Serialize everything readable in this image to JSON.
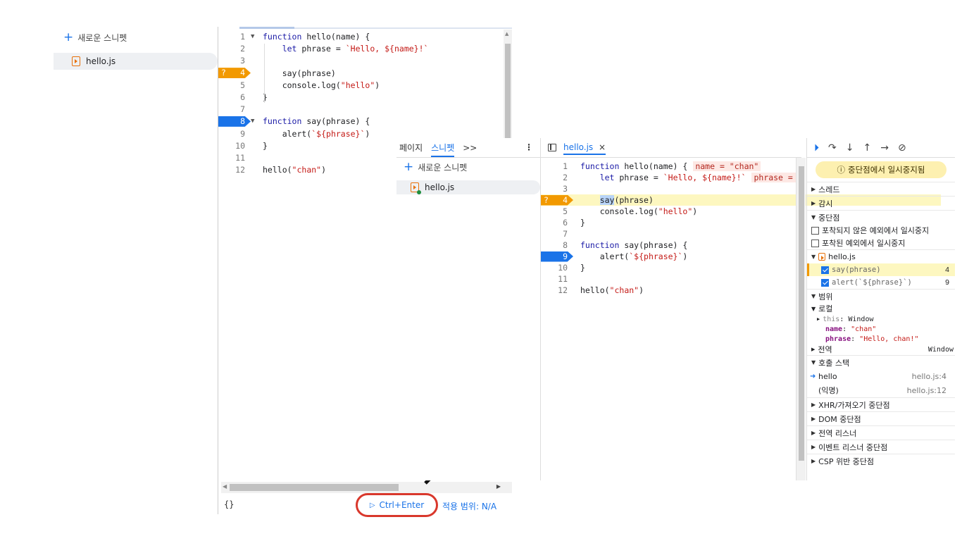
{
  "background": {
    "sidebar": {
      "new_snippet": "새로운 스니펫",
      "file": "hello.js"
    },
    "editor": {
      "lines": [
        {
          "n": "1",
          "code": "function hello(name) {"
        },
        {
          "n": "2",
          "code": "    let phrase = `Hello, ${name}!`"
        },
        {
          "n": "3",
          "code": ""
        },
        {
          "n": "4",
          "code": "    say(phrase)"
        },
        {
          "n": "5",
          "code": "    console.log(\"hello\")"
        },
        {
          "n": "6",
          "code": "}"
        },
        {
          "n": "7",
          "code": ""
        },
        {
          "n": "8",
          "code": "function say(phrase) {"
        },
        {
          "n": "9",
          "code": "    alert(`${phrase}`)"
        },
        {
          "n": "10",
          "code": "}"
        },
        {
          "n": "11",
          "code": ""
        },
        {
          "n": "12",
          "code": "hello(\"chan\")"
        }
      ],
      "bp_conditional_mark": "?"
    },
    "status": {
      "braces": "{}",
      "run_label": "Ctrl+Enter",
      "coverage": "적용 범위: N/A"
    }
  },
  "foreground": {
    "nav_tabs": {
      "page": "페이지",
      "snippets": "스니펫",
      "more": ">>",
      "menu": "⋮"
    },
    "sidebar": {
      "new_snippet": "새로운 스니펫",
      "file": "hello.js"
    },
    "editor_tab": {
      "name": "hello.js",
      "close": "×"
    },
    "inline_values": {
      "line1": "name = \"chan\"",
      "line2": "phrase = \"Hello, c"
    },
    "debugger": {
      "paused_label": "중단점에서 일시중지됨",
      "sections": {
        "threads": "스레드",
        "watch": "감시",
        "breakpoints": "중단점",
        "scope": "범위",
        "call_stack": "호출 스택",
        "xhr": "XHR/가져오기 중단점",
        "dom": "DOM 중단점",
        "global_listeners": "전역 리스너",
        "event_listeners": "이벤트 리스너 중단점",
        "csp": "CSP 위반 중단점"
      },
      "pause_uncaught": "포착되지 않은 예외에서 일시중지",
      "pause_caught": "포착된 예외에서 일시중지",
      "bp_file": "hello.js",
      "bp_items": [
        {
          "code": "say(phrase)",
          "line": "4"
        },
        {
          "code": "alert(`${phrase}`)",
          "line": "9"
        }
      ],
      "scope": {
        "local": "로컬",
        "this_key": "this",
        "this_val": "Window",
        "name_key": "name",
        "name_val": "\"chan\"",
        "phrase_key": "phrase",
        "phrase_val": "\"Hello, chan!\"",
        "global": "전역",
        "global_val": "Window"
      },
      "call_stack": [
        {
          "fn": "hello",
          "loc": "hello.js:4"
        },
        {
          "fn": "(익명)",
          "loc": "hello.js:12"
        }
      ]
    }
  },
  "colors": {
    "accent": "#1a73e8",
    "breakpoint": "#1a73e8",
    "conditional_bp": "#f29900",
    "exec_highlight": "#fdf7c0",
    "annotation": "#d9382c"
  }
}
